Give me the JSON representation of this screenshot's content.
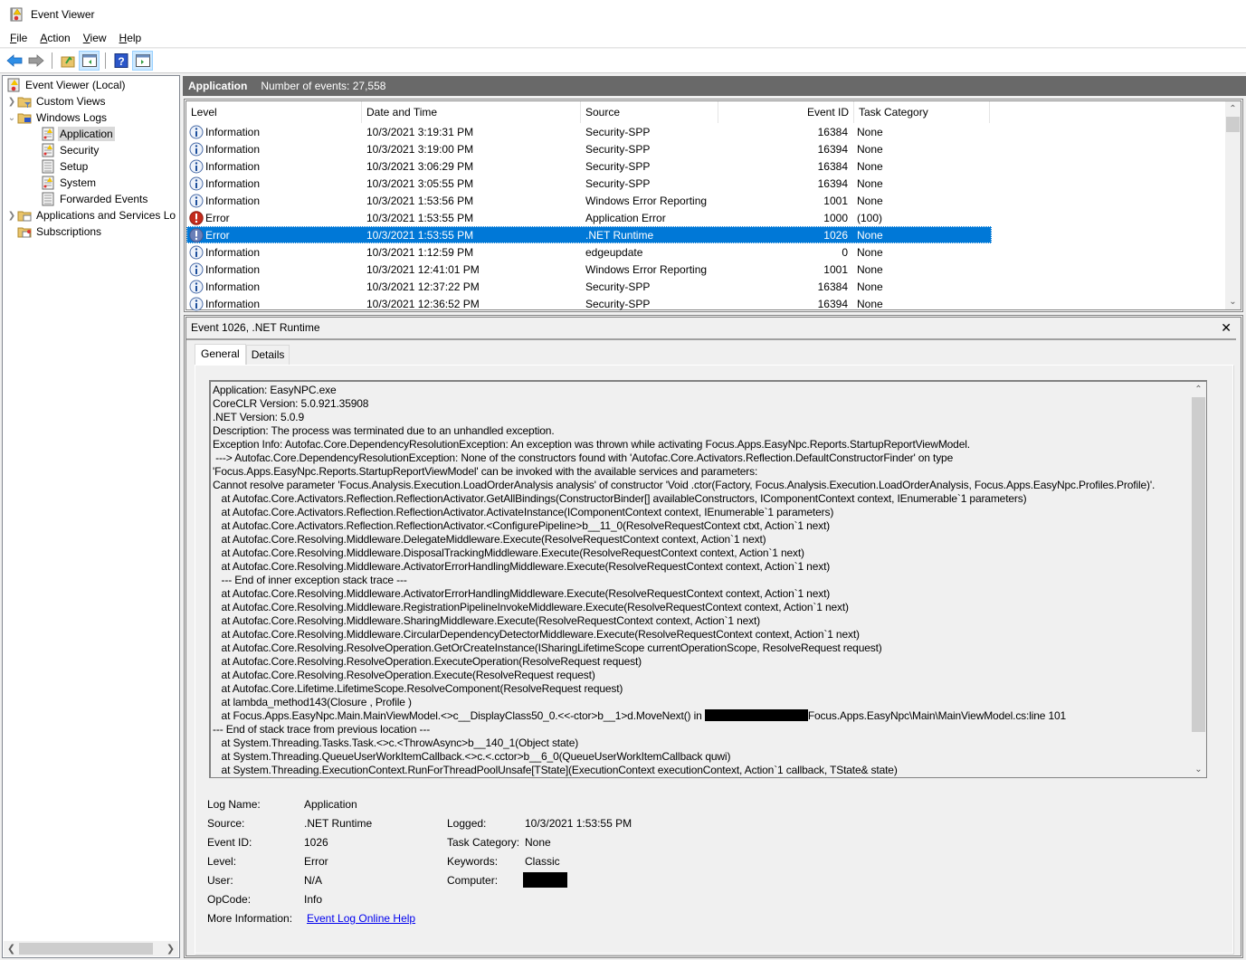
{
  "window": {
    "title": "Event Viewer"
  },
  "menu": [
    {
      "label": "File",
      "accel": "F",
      "rest": "ile"
    },
    {
      "label": "Action",
      "accel": "A",
      "rest": "ction"
    },
    {
      "label": "View",
      "accel": "V",
      "rest": "iew"
    },
    {
      "label": "Help",
      "accel": "H",
      "rest": "elp"
    }
  ],
  "toolbar": {
    "buttons": [
      "back",
      "forward",
      "up-one-level",
      "show-hide-console-tree",
      "help",
      "show-hide-action-pane"
    ]
  },
  "tree": {
    "root": "Event Viewer (Local)",
    "items": [
      {
        "label": "Custom Views",
        "expander": "collapsed"
      },
      {
        "label": "Windows Logs",
        "expander": "expanded"
      },
      {
        "label": "Application",
        "selected": true
      },
      {
        "label": "Security"
      },
      {
        "label": "Setup"
      },
      {
        "label": "System"
      },
      {
        "label": "Forwarded Events"
      },
      {
        "label": "Applications and Services Lo",
        "expander": "collapsed"
      },
      {
        "label": "Subscriptions"
      }
    ]
  },
  "log_header": {
    "name": "Application",
    "count_label": "Number of events: 27,558"
  },
  "grid": {
    "columns": [
      "Level",
      "Date and Time",
      "Source",
      "Event ID",
      "Task Category"
    ],
    "rows": [
      {
        "level": "Information",
        "icon": "info",
        "datetime": "10/3/2021 3:19:31 PM",
        "source": "Security-SPP",
        "event_id": "16384",
        "task": "None"
      },
      {
        "level": "Information",
        "icon": "info",
        "datetime": "10/3/2021 3:19:00 PM",
        "source": "Security-SPP",
        "event_id": "16394",
        "task": "None"
      },
      {
        "level": "Information",
        "icon": "info",
        "datetime": "10/3/2021 3:06:29 PM",
        "source": "Security-SPP",
        "event_id": "16384",
        "task": "None"
      },
      {
        "level": "Information",
        "icon": "info",
        "datetime": "10/3/2021 3:05:55 PM",
        "source": "Security-SPP",
        "event_id": "16394",
        "task": "None"
      },
      {
        "level": "Information",
        "icon": "info",
        "datetime": "10/3/2021 1:53:56 PM",
        "source": "Windows Error Reporting",
        "event_id": "1001",
        "task": "None"
      },
      {
        "level": "Error",
        "icon": "error",
        "datetime": "10/3/2021 1:53:55 PM",
        "source": "Application Error",
        "event_id": "1000",
        "task": "(100)"
      },
      {
        "level": "Error",
        "icon": "error",
        "datetime": "10/3/2021 1:53:55 PM",
        "source": ".NET Runtime",
        "event_id": "1026",
        "task": "None",
        "selected": true
      },
      {
        "level": "Information",
        "icon": "info",
        "datetime": "10/3/2021 1:12:59 PM",
        "source": "edgeupdate",
        "event_id": "0",
        "task": "None"
      },
      {
        "level": "Information",
        "icon": "info",
        "datetime": "10/3/2021 12:41:01 PM",
        "source": "Windows Error Reporting",
        "event_id": "1001",
        "task": "None"
      },
      {
        "level": "Information",
        "icon": "info",
        "datetime": "10/3/2021 12:37:22 PM",
        "source": "Security-SPP",
        "event_id": "16384",
        "task": "None"
      },
      {
        "level": "Information",
        "icon": "info",
        "datetime": "10/3/2021 12:36:52 PM",
        "source": "Security-SPP",
        "event_id": "16394",
        "task": "None"
      }
    ]
  },
  "detail": {
    "title": "Event 1026, .NET Runtime",
    "tabs": [
      "General",
      "Details"
    ],
    "active_tab": "General",
    "description_lines": [
      "Application: EasyNPC.exe",
      "CoreCLR Version: 5.0.921.35908",
      ".NET Version: 5.0.9",
      "Description: The process was terminated due to an unhandled exception.",
      "Exception Info: Autofac.Core.DependencyResolutionException: An exception was thrown while activating Focus.Apps.EasyNpc.Reports.StartupReportViewModel.",
      " ---> Autofac.Core.DependencyResolutionException: None of the constructors found with 'Autofac.Core.Activators.Reflection.DefaultConstructorFinder' on type",
      "'Focus.Apps.EasyNpc.Reports.StartupReportViewModel' can be invoked with the available services and parameters:",
      "Cannot resolve parameter 'Focus.Analysis.Execution.LoadOrderAnalysis analysis' of constructor 'Void .ctor(Factory, Focus.Analysis.Execution.LoadOrderAnalysis, Focus.Apps.EasyNpc.Profiles.Profile)'.",
      "   at Autofac.Core.Activators.Reflection.ReflectionActivator.GetAllBindings(ConstructorBinder[] availableConstructors, IComponentContext context, IEnumerable`1 parameters)",
      "   at Autofac.Core.Activators.Reflection.ReflectionActivator.ActivateInstance(IComponentContext context, IEnumerable`1 parameters)",
      "   at Autofac.Core.Activators.Reflection.ReflectionActivator.<ConfigurePipeline>b__11_0(ResolveRequestContext ctxt, Action`1 next)",
      "   at Autofac.Core.Resolving.Middleware.DelegateMiddleware.Execute(ResolveRequestContext context, Action`1 next)",
      "   at Autofac.Core.Resolving.Middleware.DisposalTrackingMiddleware.Execute(ResolveRequestContext context, Action`1 next)",
      "   at Autofac.Core.Resolving.Middleware.ActivatorErrorHandlingMiddleware.Execute(ResolveRequestContext context, Action`1 next)",
      "   --- End of inner exception stack trace ---",
      "   at Autofac.Core.Resolving.Middleware.ActivatorErrorHandlingMiddleware.Execute(ResolveRequestContext context, Action`1 next)",
      "   at Autofac.Core.Resolving.Middleware.RegistrationPipelineInvokeMiddleware.Execute(ResolveRequestContext context, Action`1 next)",
      "   at Autofac.Core.Resolving.Middleware.SharingMiddleware.Execute(ResolveRequestContext context, Action`1 next)",
      "   at Autofac.Core.Resolving.Middleware.CircularDependencyDetectorMiddleware.Execute(ResolveRequestContext context, Action`1 next)",
      "   at Autofac.Core.Resolving.ResolveOperation.GetOrCreateInstance(ISharingLifetimeScope currentOperationScope, ResolveRequest request)",
      "   at Autofac.Core.Resolving.ResolveOperation.ExecuteOperation(ResolveRequest request)",
      "   at Autofac.Core.Resolving.ResolveOperation.Execute(ResolveRequest request)",
      "   at Autofac.Core.Lifetime.LifetimeScope.ResolveComponent(ResolveRequest request)",
      "   at lambda_method143(Closure , Profile )",
      "   at Focus.Apps.EasyNpc.Main.MainViewModel.<>c__DisplayClass50_0.<<-ctor>b__1>d.MoveNext() in [REDACTED]Focus.Apps.EasyNpc\\Main\\MainViewModel.cs:line 101",
      "--- End of stack trace from previous location ---",
      "   at System.Threading.Tasks.Task.<>c.<ThrowAsync>b__140_1(Object state)",
      "   at System.Threading.QueueUserWorkItemCallback.<>c.<.cctor>b__6_0(QueueUserWorkItemCallback quwi)",
      "   at System.Threading.ExecutionContext.RunForThreadPoolUnsafe[TState](ExecutionContext executionContext, Action`1 callback, TState& state)"
    ],
    "properties": {
      "log_name": {
        "label": "Log Name:",
        "value": "Application"
      },
      "source": {
        "label": "Source:",
        "value": ".NET Runtime"
      },
      "event_id": {
        "label": "Event ID:",
        "value": "1026"
      },
      "level": {
        "label": "Level:",
        "value": "Error"
      },
      "user": {
        "label": "User:",
        "value": "N/A"
      },
      "opcode": {
        "label": "OpCode:",
        "value": "Info"
      },
      "more_info": {
        "label": "More Information:",
        "value": "Event Log Online Help"
      },
      "logged": {
        "label": "Logged:",
        "value": "10/3/2021 1:53:55 PM"
      },
      "task_category": {
        "label": "Task Category:",
        "value": "None"
      },
      "keywords": {
        "label": "Keywords:",
        "value": "Classic"
      },
      "computer": {
        "label": "Computer:",
        "value": "[REDACTED]"
      }
    }
  },
  "colors": {
    "selection": "#0078d7",
    "header_bar": "#696969",
    "tree_selected": "#d9d9d9",
    "error_red": "#c42b1c",
    "info_blue": "#1e5aa8",
    "link": "#0000ee"
  }
}
